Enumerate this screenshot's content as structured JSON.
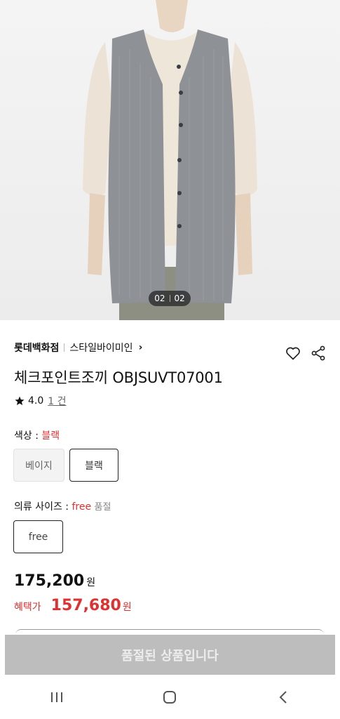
{
  "gallery": {
    "current": "02",
    "total": "02"
  },
  "brand": {
    "store": "롯데백화점",
    "seller": "스타일바이미인",
    "chevron": "›"
  },
  "product": {
    "title": "체크포인트조끼 OBJSUVT07001",
    "rating": "4.0",
    "review_count": "1 건"
  },
  "color_option": {
    "label": "색상 : ",
    "selected": "블랙",
    "choices": [
      "베이지",
      "블랙"
    ]
  },
  "size_option": {
    "label": "의류 사이즈 : ",
    "selected": "free",
    "status": "품절",
    "choices": [
      "free"
    ]
  },
  "pricing": {
    "original": "175,200",
    "currency": "원",
    "benefit_label": "혜택가",
    "benefit_price": "157,680"
  },
  "cta": {
    "label": "품절된 상품입니다"
  },
  "colors": {
    "accent": "#e03131",
    "cta_bg": "#bdbdbd"
  }
}
